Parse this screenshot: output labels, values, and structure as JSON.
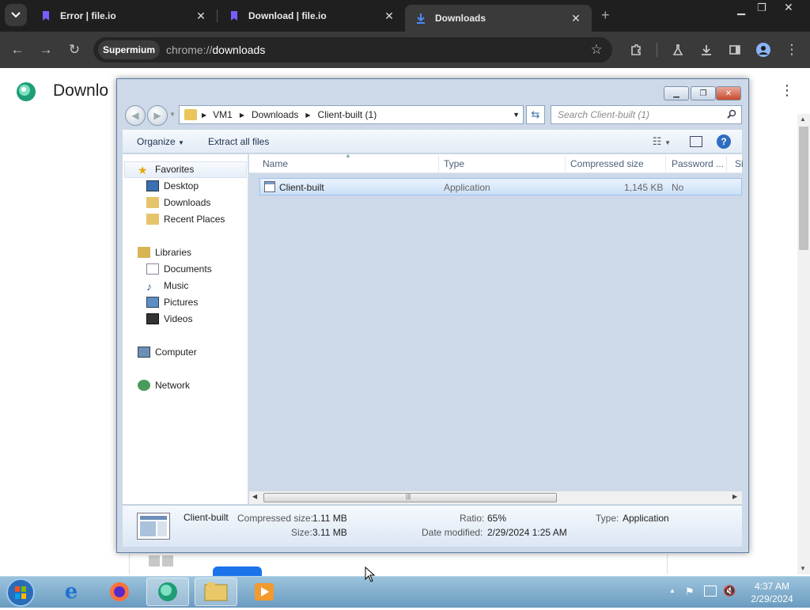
{
  "browser": {
    "tabs": [
      {
        "label": "Error | file.io",
        "active": false
      },
      {
        "label": "Download | file.io",
        "active": false
      },
      {
        "label": "Downloads",
        "active": true
      }
    ],
    "omnibox": {
      "site_chip": "Supermium",
      "url_scheme": "chrome://",
      "url_path": "downloads"
    },
    "page_title": "Downlo"
  },
  "explorer": {
    "breadcrumb": [
      "VM1",
      "Downloads",
      "Client-built (1)"
    ],
    "search_placeholder": "Search Client-built (1)",
    "commands": {
      "organize": "Organize",
      "extract": "Extract all files"
    },
    "nav": {
      "favorites": "Favorites",
      "favorites_items": [
        "Desktop",
        "Downloads",
        "Recent Places"
      ],
      "libraries": "Libraries",
      "libraries_items": [
        "Documents",
        "Music",
        "Pictures",
        "Videos"
      ],
      "computer": "Computer",
      "network": "Network"
    },
    "columns": [
      "Name",
      "Type",
      "Compressed size",
      "Password ...",
      "Si"
    ],
    "file": {
      "name": "Client-built",
      "type": "Application",
      "compressed_size": "1,145 KB",
      "password": "No"
    },
    "details": {
      "name": "Client-built",
      "compressed_label": "Compressed size:",
      "compressed_value": "1.11 MB",
      "size_label": "Size:",
      "size_value": "3.11 MB",
      "ratio_label": "Ratio:",
      "ratio_value": "65%",
      "date_label": "Date modified:",
      "date_value": "2/29/2024 1:25 AM",
      "type_label": "Type:",
      "type_value": "Application"
    }
  },
  "taskbar": {
    "time": "4:37 AM",
    "date": "2/29/2024"
  },
  "colors": {
    "tabbar": "#1f1f1f",
    "toolbar": "#3a3a3a",
    "selection": "#cce0f7",
    "taskbar": "#6a9bc0"
  }
}
